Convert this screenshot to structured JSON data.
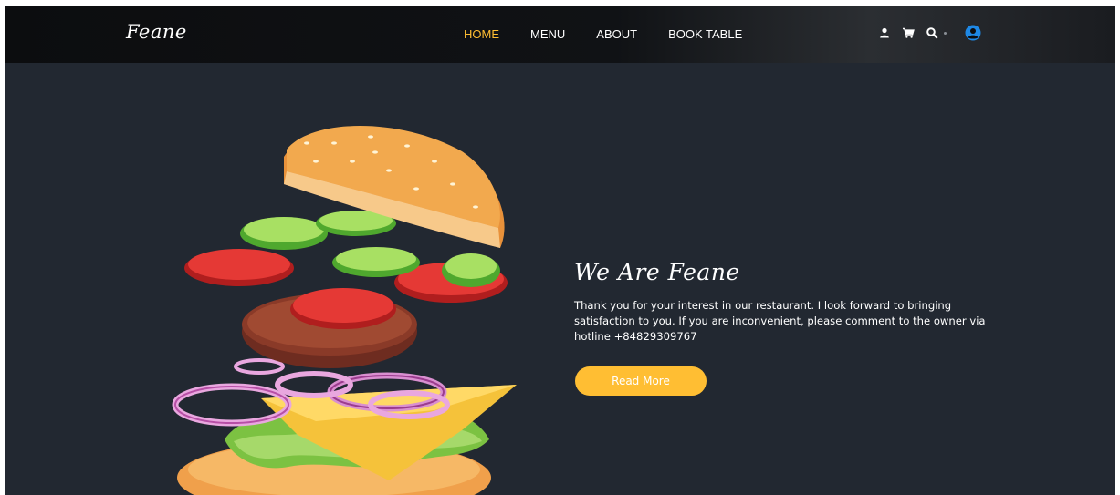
{
  "header": {
    "logo": "Feane",
    "nav": [
      {
        "label": "HOME",
        "active": true
      },
      {
        "label": "MENU",
        "active": false
      },
      {
        "label": "ABOUT",
        "active": false
      },
      {
        "label": "BOOK TABLE",
        "active": false
      }
    ],
    "icons": [
      "user-icon",
      "cart-icon",
      "search-icon",
      "account-circle-icon"
    ]
  },
  "hero": {
    "title": "We Are Feane",
    "text": "Thank you for your interest in our restaurant. I look forward to bringing satisfaction to you. If you are inconvenient, please comment to the owner via hotline +84829309767",
    "button_label": "Read More",
    "image": "burger-illustration"
  },
  "colors": {
    "background": "#222831",
    "navbar": "#0c0d0f",
    "accent": "#ffbe33",
    "text": "#ffffff",
    "account_icon": "#1e88e5"
  }
}
